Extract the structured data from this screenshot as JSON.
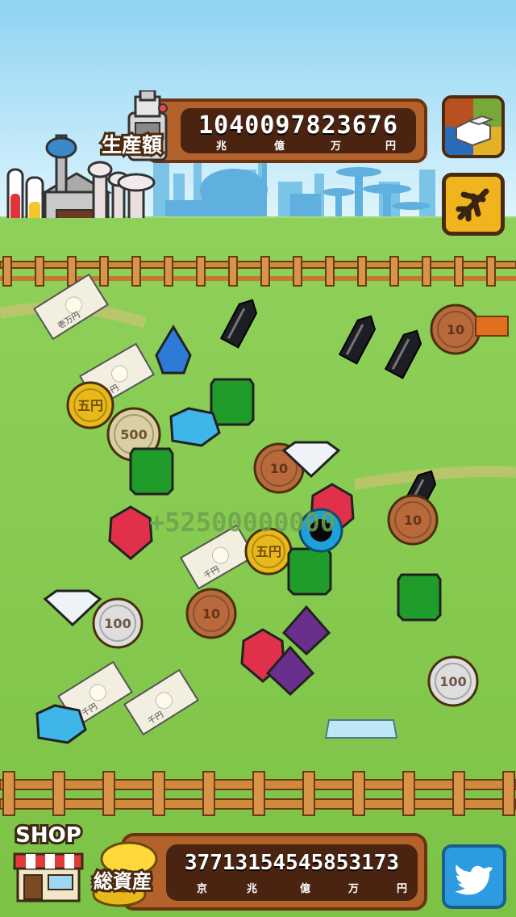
{
  "header": {
    "production_label": "生産額",
    "production_value": "1040097823676",
    "production_units": [
      "兆",
      "億",
      "万",
      "円"
    ]
  },
  "footer": {
    "shop_label": "SHOP",
    "assets_label": "総資産",
    "assets_value": "37713154545853173",
    "assets_units": [
      "京",
      "兆",
      "億",
      "万",
      "円"
    ]
  },
  "field": {
    "floating_text": "+52500000000",
    "coin_labels": {
      "yen10": "10",
      "yen100": "100",
      "yen500": "500",
      "yen5": "五円"
    },
    "bill_labels": {
      "man": "壱万円",
      "sen": "千円"
    }
  },
  "icons": {
    "map": "block-map-icon",
    "travel": "airplane-icon",
    "twitter": "twitter-bird-icon"
  },
  "colors": {
    "panel": "#b4622b",
    "panel_inner": "#4a2410",
    "travel_button": "#f0b51e",
    "twitter_button": "#2d9be0"
  }
}
